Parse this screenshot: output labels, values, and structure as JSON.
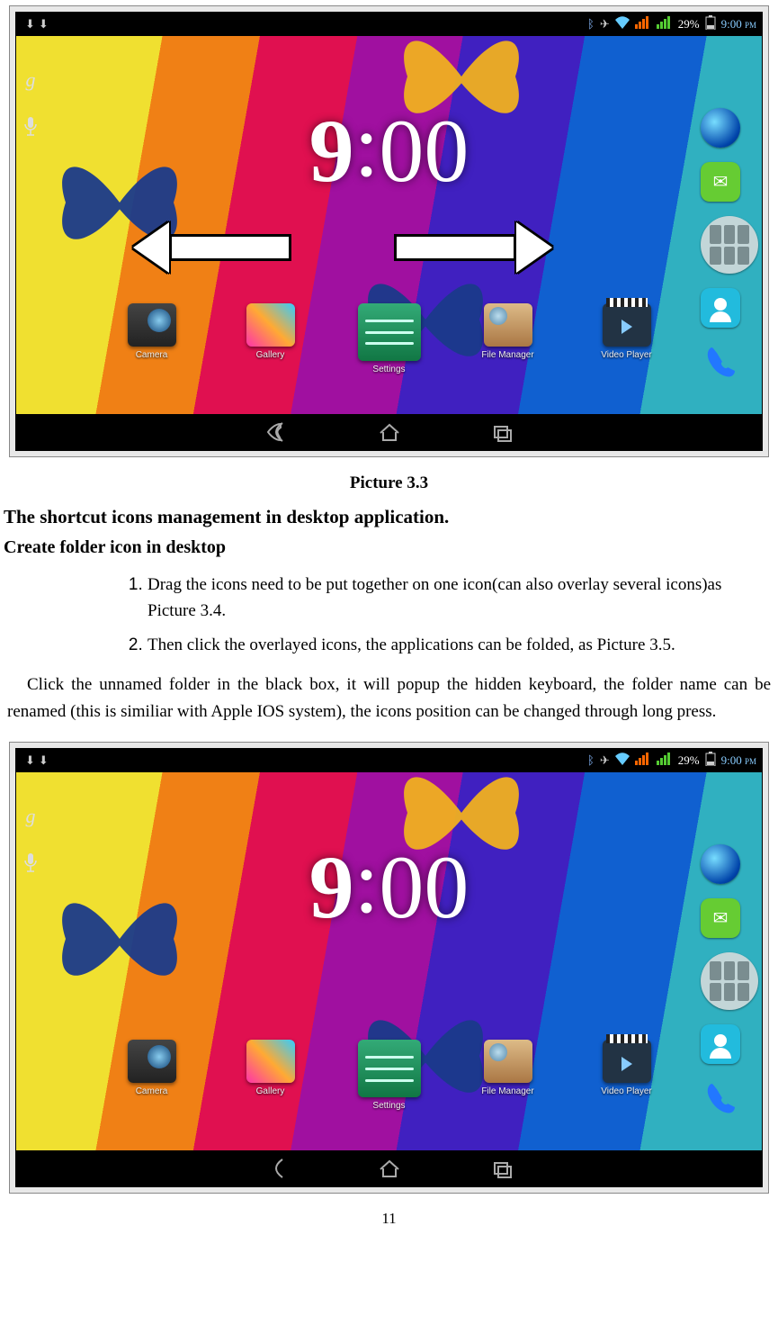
{
  "page_number": "11",
  "caption_1": "Picture 3.3",
  "status": {
    "battery": "29%",
    "time": "9:00",
    "ampm": "PM"
  },
  "home_clock": {
    "hours": "9",
    "mins": "00"
  },
  "apps": [
    {
      "name": "Camera"
    },
    {
      "name": "Gallery"
    },
    {
      "name": "Settings"
    },
    {
      "name": "File Manager"
    },
    {
      "name": "Video Player"
    }
  ],
  "heading_1": "The shortcut icons management in desktop application.",
  "heading_2": "Create folder icon in desktop",
  "list": [
    "Drag the icons need to be put together on one icon(can also overlay several icons)as Picture 3.4.",
    "Then click the overlayed icons, the applications can be folded, as Picture 3.5."
  ],
  "body": "Click the unnamed folder in the black box, it will popup the hidden keyboard, the folder name can be renamed (this is similiar with Apple IOS system), the icons position can be changed through long press."
}
